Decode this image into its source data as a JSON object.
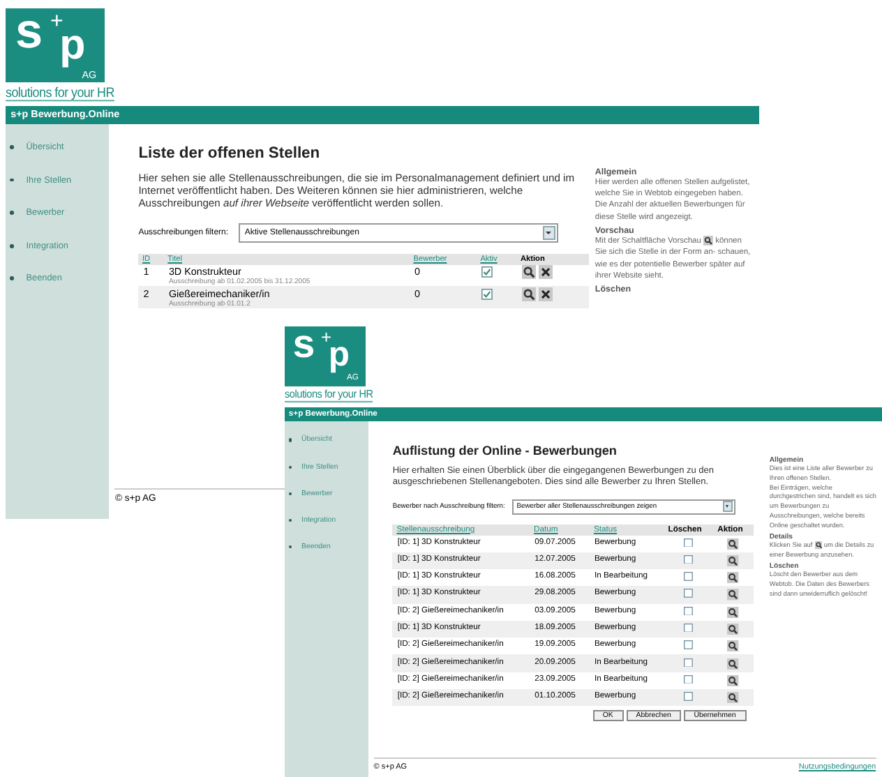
{
  "back_window": {
    "logo": {
      "letter_s": "s",
      "plus": "+",
      "letter_p": "p",
      "suffix": "AG",
      "tagline": "solutions for your HR"
    },
    "header": "s+p Bewerbung.Online",
    "nav": [
      "Übersicht",
      "Ihre Stellen",
      "Bewerber",
      "Integration",
      "Beenden"
    ],
    "title": "Liste der offenen Stellen",
    "intro": "Hier sehen sie alle Stellenausschreibungen, die sie im Personalmanagement definiert und im Internet veröffentlicht haben. Des Weiteren können sie hier administrieren, welche Ausschreibungen *auf ihrer Webseite* veröffentlicht werden sollen.",
    "filter": {
      "label": "Ausschreibungen filtern:",
      "value": "Aktive Stellenausschreibungen"
    },
    "table": {
      "columns": [
        {
          "label": "ID",
          "link": true
        },
        {
          "label": "Titel",
          "link": true
        },
        {
          "label": "Bewerber",
          "link": true
        },
        {
          "label": "Aktiv",
          "link": true
        },
        {
          "label": "Aktion",
          "link": false
        }
      ],
      "rows": [
        {
          "id": "1",
          "title": "3D Konstrukteur",
          "period": "Ausschreibung ab 01.02.2005 bis 31.12.2005",
          "applicants": "0",
          "active": true
        },
        {
          "id": "2",
          "title": "Gießereimechaniker/in",
          "period": "Ausschreibung ab 01.01.2",
          "applicants": "0",
          "active": true
        }
      ]
    },
    "help": [
      {
        "kind": "heading",
        "text": "Allgemein"
      },
      {
        "kind": "text",
        "text": "Hier werden alle offenen Stellen aufgelistet, welche Sie in Webtob eingegeben haben. Die Anzahl der aktuellen Bewerbungen für diese Stelle wird angezeigt."
      },
      {
        "kind": "heading",
        "text": "Vorschau"
      },
      {
        "kind": "text_icon",
        "before": "Mit der Schaltfläche Vorschau",
        "after": "können Sie sich die Stelle in der Form an- schauen, wie es der potentielle Bewerber später auf ihrer Website sieht."
      },
      {
        "kind": "heading",
        "text": "Löschen"
      }
    ],
    "footer": "© s+p AG"
  },
  "front_window": {
    "logo": {
      "letter_s": "s",
      "plus": "+",
      "letter_p": "p",
      "suffix": "AG",
      "tagline": "solutions for your HR"
    },
    "header": "s+p Bewerbung.Online",
    "nav": [
      "Übersicht",
      "Ihre Stellen",
      "Bewerber",
      "Integration",
      "Beenden"
    ],
    "title": "Auflistung der Online - Bewerbungen",
    "intro": "Hier erhalten Sie einen Überblick über die eingegangenen Bewerbungen zu den ausgeschriebenen Stellenangeboten. Dies sind alle Bewerber zu Ihren Stellen.",
    "filter": {
      "label": "Bewerber nach Ausschreibung filtern:",
      "value": "Bewerber aller Stellenausschreibungen zeigen"
    },
    "table": {
      "columns": [
        {
          "label": "Stellenausschreibung",
          "link": true
        },
        {
          "label": "Datum",
          "link": true
        },
        {
          "label": "Status",
          "link": true
        },
        {
          "label": "Löschen",
          "link": false
        },
        {
          "label": "Aktion",
          "link": false
        }
      ],
      "rows": [
        {
          "posting": "[ID: 1] 3D Konstrukteur",
          "date": "09.07.2005",
          "status": "Bewerbung",
          "delete": false
        },
        {
          "posting": "[ID: 1] 3D Konstrukteur",
          "date": "12.07.2005",
          "status": "Bewerbung",
          "delete": false
        },
        {
          "posting": "[ID: 1] 3D Konstrukteur",
          "date": "16.08.2005",
          "status": "In Bearbeitung",
          "delete": false
        },
        {
          "posting": "[ID: 1] 3D Konstrukteur",
          "date": "29.08.2005",
          "status": "Bewerbung",
          "delete": false
        },
        {
          "posting": "[ID: 2] Gießereimechaniker/in",
          "date": "03.09.2005",
          "status": "Bewerbung",
          "delete": false
        },
        {
          "posting": "[ID: 1] 3D Konstrukteur",
          "date": "18.09.2005",
          "status": "Bewerbung",
          "delete": false
        },
        {
          "posting": "[ID: 2] Gießereimechaniker/in",
          "date": "19.09.2005",
          "status": "Bewerbung",
          "delete": false
        },
        {
          "posting": "[ID: 2] Gießereimechaniker/in",
          "date": "20.09.2005",
          "status": "In Bearbeitung",
          "delete": false
        },
        {
          "posting": "[ID: 2] Gießereimechaniker/in",
          "date": "23.09.2005",
          "status": "In Bearbeitung",
          "delete": false
        },
        {
          "posting": "[ID: 2] Gießereimechaniker/in",
          "date": "01.10.2005",
          "status": "Bewerbung",
          "delete": false
        }
      ]
    },
    "buttons": [
      "OK",
      "Abbrechen",
      "Übernehmen"
    ],
    "help": [
      {
        "kind": "heading",
        "text": "Allgemein"
      },
      {
        "kind": "text",
        "text": "Dies ist eine Liste aller Bewerber zu Ihren offenen Stellen."
      },
      {
        "kind": "text",
        "text": "Bei Einträgen, welche durchgestrichen sind, handelt es sich um Bewerbungen zu Ausschreibungen, welche bereits Online geschaltet wurden."
      },
      {
        "kind": "heading",
        "text": "Details"
      },
      {
        "kind": "text_icon",
        "before": "Klicken Sie auf",
        "after": "um die Details zu einer Bewerbung anzusehen."
      },
      {
        "kind": "heading",
        "text": "Löschen"
      },
      {
        "kind": "text",
        "text": "Löscht den Bewerber aus dem Webtob. Die Daten des Bewerbers sind dann unwiderruflich gelöscht!"
      }
    ],
    "footer": "© s+p AG",
    "footer_link": "Nutzungsbedingungen"
  }
}
